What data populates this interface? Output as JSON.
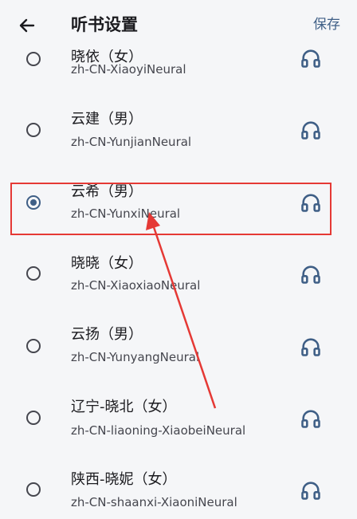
{
  "header": {
    "back_icon": "arrow-left-icon",
    "title": "听书设置",
    "save_label": "保存"
  },
  "voices": [
    {
      "name": "晓依（女）",
      "id": "zh-CN-XiaoyiNeural",
      "selected": false,
      "preview_icon": "headphones-icon"
    },
    {
      "name": "云建（男）",
      "id": "zh-CN-YunjianNeural",
      "selected": false,
      "preview_icon": "headphones-icon"
    },
    {
      "name": "云希（男）",
      "id": "zh-CN-YunxiNeural",
      "selected": true,
      "preview_icon": "headphones-icon"
    },
    {
      "name": "晓晓（女）",
      "id": "zh-CN-XiaoxiaoNeural",
      "selected": false,
      "preview_icon": "headphones-icon"
    },
    {
      "name": "云扬（男）",
      "id": "zh-CN-YunyangNeural",
      "selected": false,
      "preview_icon": "headphones-icon"
    },
    {
      "name": "辽宁-晓北（女）",
      "id": "zh-CN-liaoning-XiaobeiNeural",
      "selected": false,
      "preview_icon": "headphones-icon"
    },
    {
      "name": "陕西-晓妮（女）",
      "id": "zh-CN-shaanxi-XiaoniNeural",
      "selected": false,
      "preview_icon": "headphones-icon"
    }
  ],
  "colors": {
    "accent": "#3f5f86",
    "annotation": "#e53935",
    "background": "#f5f6f8"
  }
}
